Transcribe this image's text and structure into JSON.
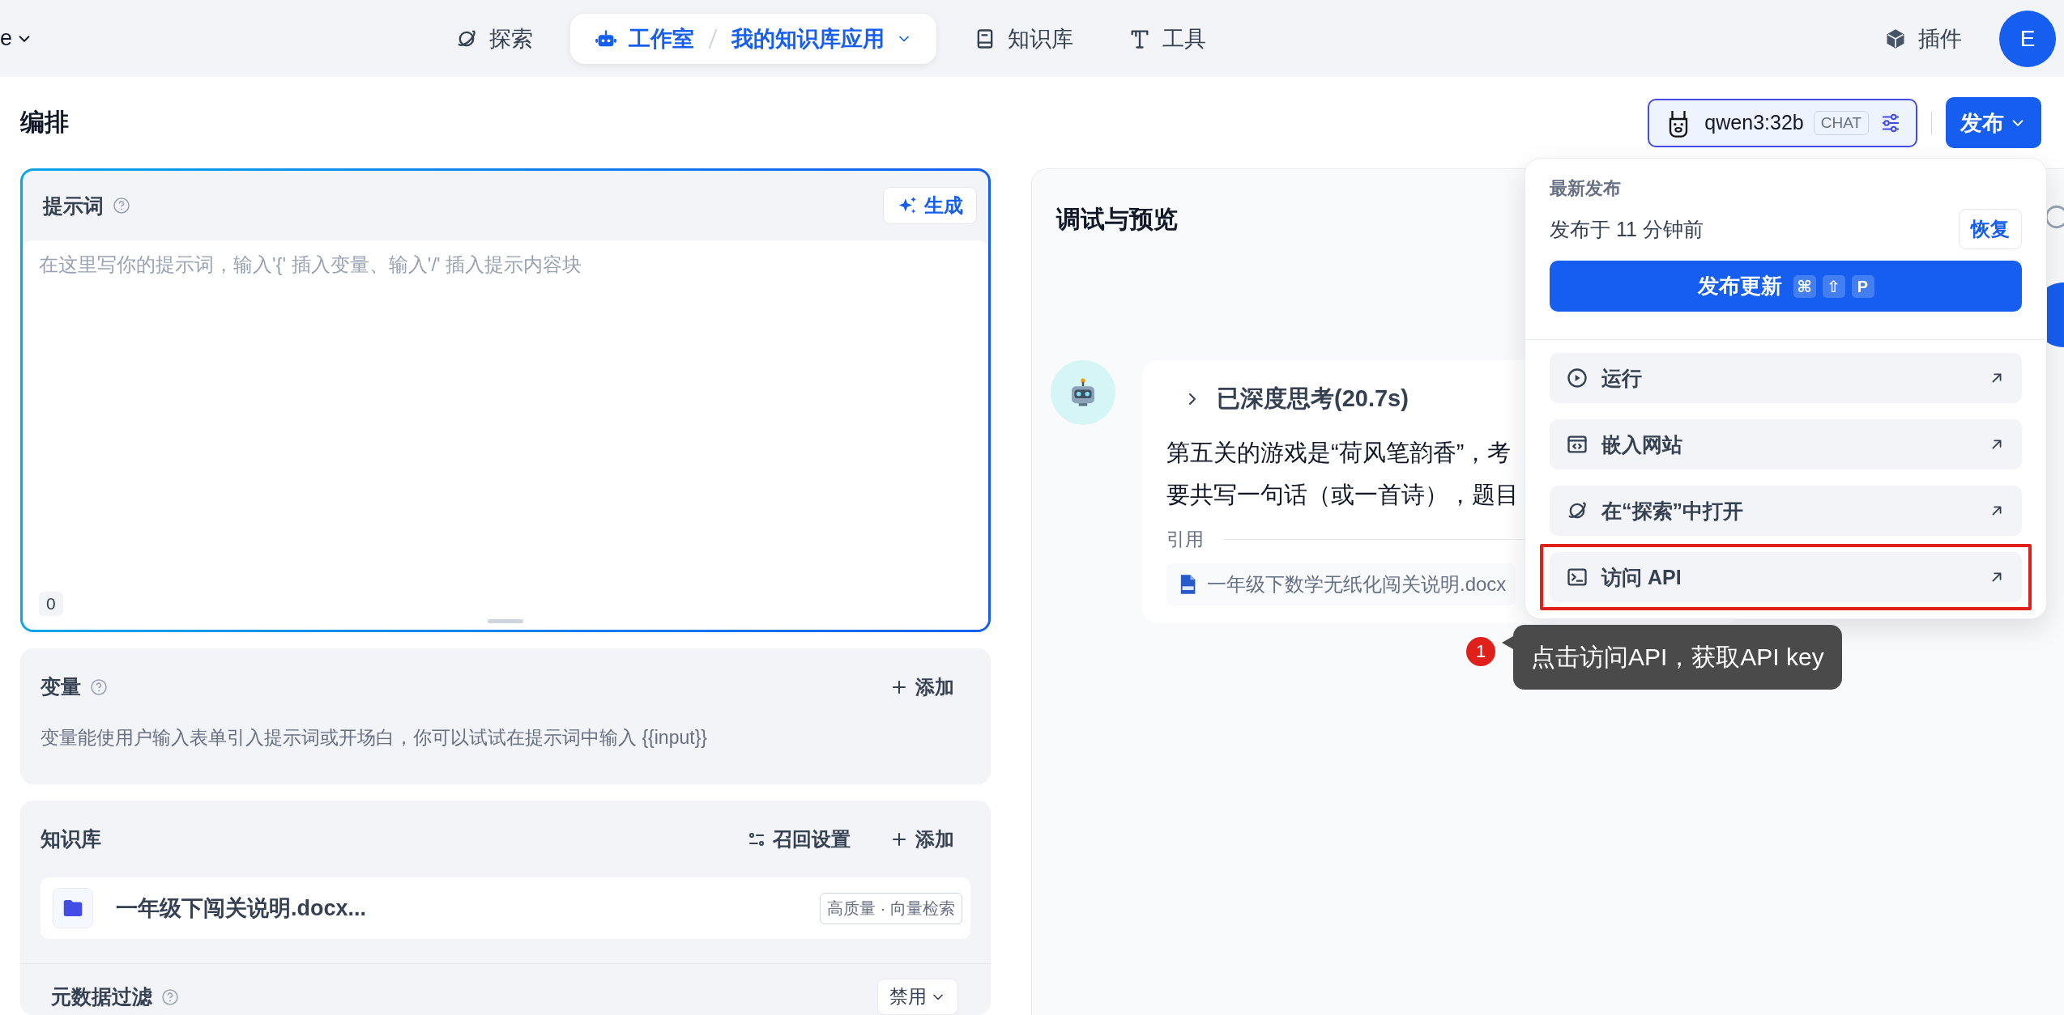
{
  "top_nav": {
    "workspace": "e",
    "items": [
      {
        "label": "探索",
        "selected": false
      },
      {
        "label": "工作室",
        "selected": true,
        "app": "我的知识库应用"
      },
      {
        "label": "知识库",
        "selected": false
      },
      {
        "label": "工具",
        "selected": false
      }
    ],
    "plugins": "插件",
    "avatar": "E"
  },
  "header": {
    "title": "编排",
    "model": {
      "name": "qwen3:32b",
      "mode": "CHAT"
    },
    "publish_button": "发布"
  },
  "prompt": {
    "title": "提示词",
    "generate_button": "生成",
    "placeholder": "在这里写你的提示词，输入'{' 插入变量、输入'/' 插入提示内容块",
    "char_count": "0"
  },
  "variables": {
    "title": "变量",
    "add_button": "添加",
    "description": "变量能使用户输入表单引入提示词或开场白，你可以试试在提示词中输入 {{input}}"
  },
  "knowledge": {
    "title": "知识库",
    "retrieval_button": "召回设置",
    "add_button": "添加",
    "datasets": [
      {
        "name": "一年级下闯关说明.docx...",
        "tag": "高质量 · 向量检索"
      }
    ]
  },
  "metadata_filter": {
    "title": "元数据过滤",
    "value": "禁用"
  },
  "debug": {
    "title": "调试与预览",
    "message": {
      "thinking": "已深度思考(20.7s)",
      "expanded": false,
      "lines": [
        "第五关的游戏是“荷风笔韵香”，考",
        "要共写一句话（或一首诗），题目"
      ],
      "citation_label": "引用",
      "citations": [
        "一年级下数学无纸化闯关说明.docx"
      ]
    }
  },
  "publish_menu": {
    "section_label": "最新发布",
    "published_time": "发布于 11 分钟前",
    "restore_button": "恢复",
    "update_button": "发布更新",
    "shortcut": [
      "⌘",
      "⇧",
      "P"
    ],
    "actions": [
      {
        "label": "运行",
        "highlighted": false
      },
      {
        "label": "嵌入网站",
        "highlighted": false
      },
      {
        "label": "在“探索”中打开",
        "highlighted": false
      },
      {
        "label": "访问 API",
        "highlighted": true
      }
    ]
  },
  "callout": {
    "number": "1",
    "text": "点击访问API，获取API key"
  }
}
